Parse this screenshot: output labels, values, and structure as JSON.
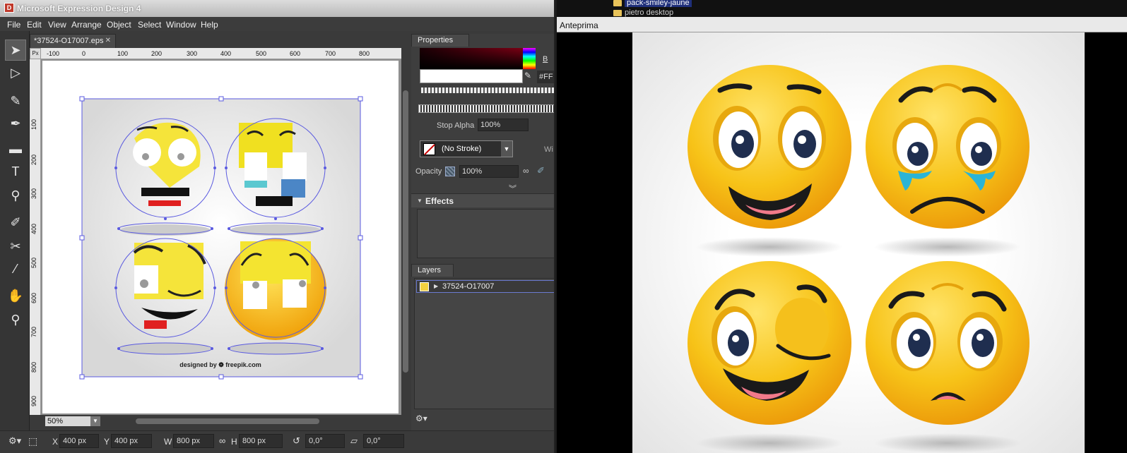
{
  "app": {
    "title": "Microsoft Expression Design 4",
    "menu": [
      "File",
      "Edit",
      "View",
      "Arrange",
      "Object",
      "Select",
      "Window",
      "Help"
    ]
  },
  "document": {
    "tab_label": "*37524-O17007.eps",
    "ruler_unit": "Px",
    "ruler_h_ticks": [
      "-100",
      "0",
      "100",
      "200",
      "300",
      "400",
      "500",
      "600",
      "700",
      "800"
    ],
    "ruler_v_ticks": [
      "100",
      "200",
      "300",
      "400",
      "500",
      "600",
      "700",
      "800",
      "900"
    ],
    "credit_text": "designed by ❁ freepik.com",
    "zoom": "50%"
  },
  "properties": {
    "tab_label": "Properties",
    "hex_value": "#FF",
    "b_label": "B",
    "stop_alpha_label": "Stop Alpha",
    "stop_alpha_value": "100%",
    "stroke_value": "(No Stroke)",
    "width_label": "Wi",
    "opacity_label": "Opacity",
    "opacity_value": "100%",
    "effects_label": "Effects",
    "layers_label": "Layers",
    "layer_name": "37524-O17007"
  },
  "statusbar": {
    "x_label": "X",
    "x_value": "400 px",
    "y_label": "Y",
    "y_value": "400 px",
    "w_label": "W",
    "w_value": "800 px",
    "h_label": "H",
    "h_value": "800 px",
    "rotation_value": "0,0°",
    "skew_value": "0,0°"
  },
  "file_tree": {
    "selected_item": "pack-smiley-jaune",
    "next_item": "pietro desktop"
  },
  "preview": {
    "title": "Anteprima"
  },
  "colors": {
    "smiley_yellow": "#f7c318",
    "smiley_orange": "#f0a10a",
    "selection_blue": "#5a5ae0"
  }
}
